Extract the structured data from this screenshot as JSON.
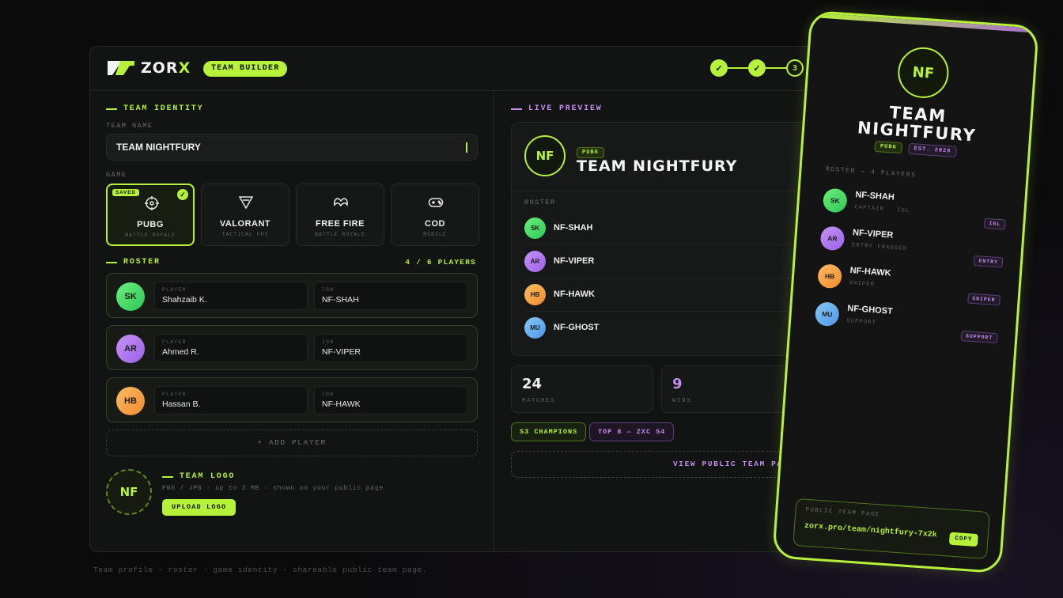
{
  "brand": {
    "name_prefix": "ZOR",
    "name_suffix": "X",
    "badge": "TEAM BUILDER"
  },
  "stepper": {
    "steps": [
      "✓",
      "✓",
      "3"
    ],
    "current": 3
  },
  "identity": {
    "section_label": "TEAM IDENTITY",
    "team_name_label": "TEAM NAME",
    "team_name_value": "TEAM NIGHTFURY",
    "game_label": "GAME",
    "games": [
      {
        "name": "PUBG",
        "sub": "BATTLE ROYALE",
        "icon": "crosshair-icon",
        "selected": true,
        "badge": "SAVED"
      },
      {
        "name": "VALORANT",
        "sub": "TACTICAL FPS",
        "icon": "valorant-icon",
        "selected": false
      },
      {
        "name": "FREE FIRE",
        "sub": "BATTLE ROYALE",
        "icon": "wings-icon",
        "selected": false
      },
      {
        "name": "COD",
        "sub": "MOBILE",
        "icon": "gamepad-icon",
        "selected": false
      }
    ]
  },
  "roster": {
    "section_label": "ROSTER",
    "count": "4 / 6 PLAYERS",
    "player_label": "PLAYER",
    "ign_label": "IGN",
    "players": [
      {
        "initials": "SK",
        "name": "Shahzaib K.",
        "ign": "NF-SHAH"
      },
      {
        "initials": "AR",
        "name": "Ahmed R.",
        "ign": "NF-VIPER"
      },
      {
        "initials": "HB",
        "name": "Hassan B.",
        "ign": "NF-HAWK"
      }
    ],
    "add_label": "+ ADD PLAYER"
  },
  "team_logo": {
    "initials": "NF",
    "label": "TEAM LOGO",
    "hint": "PNG / JPG · up to 2 MB · shown on your public page",
    "upload_label": "UPLOAD LOGO"
  },
  "preview": {
    "section_label": "LIVE PREVIEW",
    "initials": "NF",
    "game_pill": "PUBG",
    "title": "TEAM NIGHTFURY",
    "roster_label": "ROSTER",
    "roster": [
      {
        "initials": "SK",
        "ign": "NF-SHAH"
      },
      {
        "initials": "AR",
        "ign": "NF-VIPER"
      },
      {
        "initials": "HB",
        "ign": "NF-HAWK"
      },
      {
        "initials": "MU",
        "ign": "NF-GHOST"
      }
    ],
    "stats": [
      {
        "value": "24",
        "label": "MATCHES"
      },
      {
        "value": "9",
        "label": "WINS"
      }
    ],
    "achievements": [
      "S3 CHAMPIONS",
      "TOP 8 — ZXC S4"
    ],
    "view_label": "VIEW PUBLIC TEAM PA"
  },
  "footer_note": "Team profile · roster · game identity · shareable public team page.",
  "phone": {
    "initials": "NF",
    "title_line1": "TEAM",
    "title_line2": "NIGHTFURY",
    "game_pill": "PUBG",
    "est_pill": "EST. 2026",
    "roster_label": "ROSTER — 4 PLAYERS",
    "players": [
      {
        "initials": "SK",
        "ign": "NF-SHAH",
        "role": "CAPTAIN · IGL",
        "tag": "IGL"
      },
      {
        "initials": "AR",
        "ign": "NF-VIPER",
        "role": "ENTRY FRAGGER",
        "tag": "ENTRY"
      },
      {
        "initials": "HB",
        "ign": "NF-HAWK",
        "role": "SNIPER",
        "tag": "SNIPER"
      },
      {
        "initials": "MU",
        "ign": "NF-GHOST",
        "role": "SUPPORT",
        "tag": "SUPPORT"
      }
    ],
    "public_label": "PUBLIC TEAM PAGE",
    "public_url": "zorx.pro/team/nightfury-7x2k",
    "copy_label": "COPY"
  },
  "colors": {
    "accent": "#b6f23a",
    "secondary": "#c68cf0",
    "avatar_sk": "#4ee06a",
    "avatar_ar": "#b47ef0",
    "avatar_hb": "#f6a64a",
    "avatar_mu": "#6ab6f0"
  }
}
